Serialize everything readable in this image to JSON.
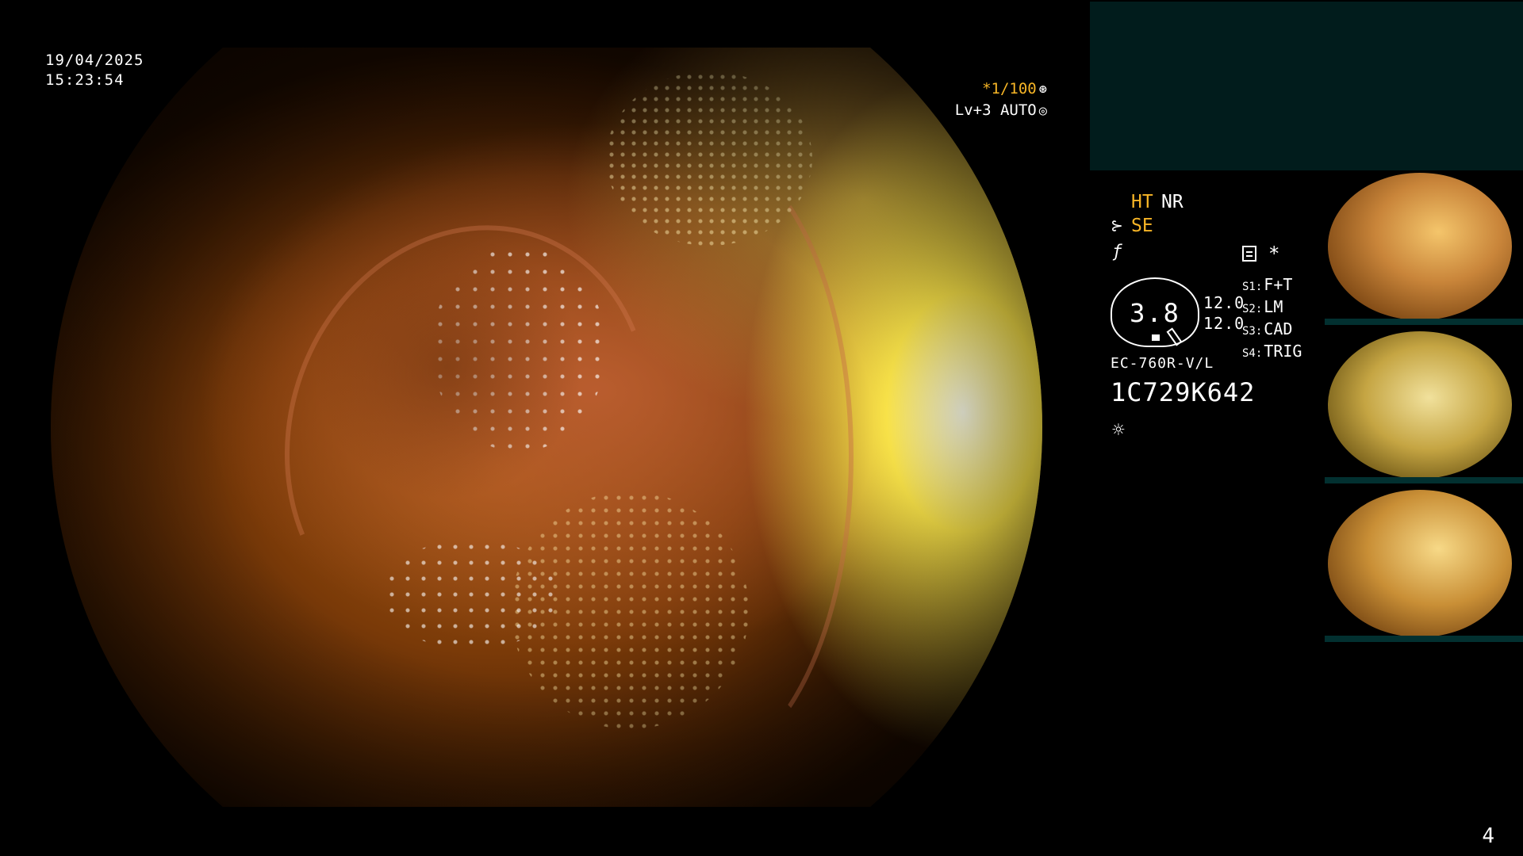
{
  "overlay": {
    "date": "19/04/2025",
    "time": "15:23:54",
    "shutter_speed": "*1/100",
    "shutter_icon": "aperture-icon",
    "level": "Lv+3 AUTO",
    "level_icon": "iris-auto-icon"
  },
  "panel": {
    "ht": "HT",
    "nr": "NR",
    "se": "SE",
    "se_icon": "structure-enhance-icon",
    "f_icon": "freeze-icon",
    "memo_icon": "memo-icon",
    "asterisk": "*",
    "dial_value": "3.8",
    "ratio_1": "12.0",
    "ratio_2": "12.0",
    "s_keys": [
      "S1:",
      "S2:",
      "S3:",
      "S4:"
    ],
    "s_values": [
      "F+T",
      "LM",
      "CAD",
      "TRIG"
    ],
    "model": "EC-760R-V/L",
    "serial": "1C729K642",
    "light_icon": "light-source-icon"
  },
  "thumbnails": [
    {
      "name": "capture-1"
    },
    {
      "name": "capture-2"
    },
    {
      "name": "capture-3"
    }
  ],
  "page_number": "4",
  "colors": {
    "accent_orange": "#f7b526",
    "panel_teal": "#011c1c"
  }
}
